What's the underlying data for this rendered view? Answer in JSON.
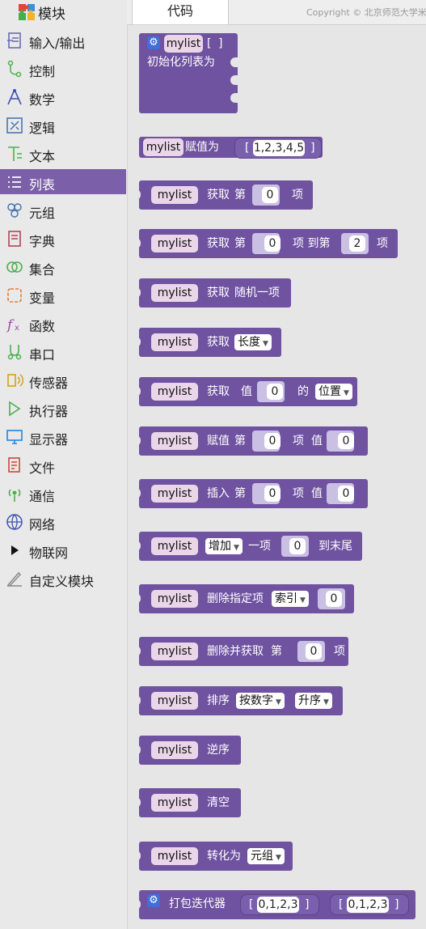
{
  "sidebar": {
    "title": "模块",
    "categories": [
      {
        "label": "输入/输出",
        "icon": "io-icon"
      },
      {
        "label": "控制",
        "icon": "control-icon"
      },
      {
        "label": "数学",
        "icon": "math-icon"
      },
      {
        "label": "逻辑",
        "icon": "logic-icon"
      },
      {
        "label": "文本",
        "icon": "text-icon"
      },
      {
        "label": "列表",
        "icon": "list-icon",
        "selected": true
      },
      {
        "label": "元组",
        "icon": "tuple-icon"
      },
      {
        "label": "字典",
        "icon": "dict-icon"
      },
      {
        "label": "集合",
        "icon": "set-icon"
      },
      {
        "label": "变量",
        "icon": "variable-icon"
      },
      {
        "label": "函数",
        "icon": "function-icon"
      },
      {
        "label": "串口",
        "icon": "serial-icon"
      },
      {
        "label": "传感器",
        "icon": "sensor-icon"
      },
      {
        "label": "执行器",
        "icon": "actuator-icon"
      },
      {
        "label": "显示器",
        "icon": "display-icon"
      },
      {
        "label": "文件",
        "icon": "file-icon"
      },
      {
        "label": "通信",
        "icon": "communication-icon"
      },
      {
        "label": "网络",
        "icon": "network-icon"
      },
      {
        "label": "物联网",
        "icon": "iot-icon"
      },
      {
        "label": "自定义模块",
        "icon": "custom-module-icon"
      }
    ]
  },
  "tabs": {
    "code": "代码",
    "copyright": "Copyright © 北京师范大学米"
  },
  "colors": {
    "list_block": "#6f52a0",
    "selected_category": "#7b5fa8",
    "variable_pill": "#ead6e8"
  },
  "blocks": {
    "var": "mylist",
    "b0": {
      "open": "[",
      "close": "]",
      "text": "初始化列表为"
    },
    "b1": {
      "assign": "赋值为",
      "open": "[",
      "value": "1,2,3,4,5",
      "close": "]"
    },
    "b2": {
      "get": "获取",
      "idx": "第",
      "n": "0",
      "item": "项"
    },
    "b3": {
      "get": "获取",
      "idx": "第",
      "n1": "0",
      "to": "项 到第",
      "n2": "2",
      "item": "项"
    },
    "b4": {
      "get": "获取",
      "random": "随机一项"
    },
    "b5": {
      "get": "获取",
      "dd": "长度"
    },
    "b6": {
      "get": "获取",
      "val": "值",
      "n": "0",
      "of": "的",
      "dd": "位置"
    },
    "b7": {
      "assign": "赋值",
      "idx": "第",
      "n1": "0",
      "item": "项",
      "val": "值",
      "n2": "0"
    },
    "b8": {
      "insert": "插入",
      "idx": "第",
      "n1": "0",
      "item": "项",
      "val": "值",
      "n2": "0"
    },
    "b9": {
      "dd": "增加",
      "one": "一项",
      "n": "0",
      "end": "到末尾"
    },
    "b10": {
      "del": "删除指定项",
      "dd": "索引",
      "n": "0"
    },
    "b11": {
      "del": "删除并获取",
      "idx": "第",
      "n": "0",
      "item": "项"
    },
    "b12": {
      "sort": "排序",
      "dd1": "按数字",
      "dd2": "升序"
    },
    "b13": {
      "reverse": "逆序"
    },
    "b14": {
      "clear": "清空"
    },
    "b15": {
      "convert": "转化为",
      "dd": "元组"
    },
    "b16": {
      "zip": "打包迭代器",
      "t1": "[",
      "v1": "0,1,2,3",
      "t1c": "]",
      "t2": "[",
      "v2": "0,1,2,3",
      "t2c": "]"
    }
  }
}
